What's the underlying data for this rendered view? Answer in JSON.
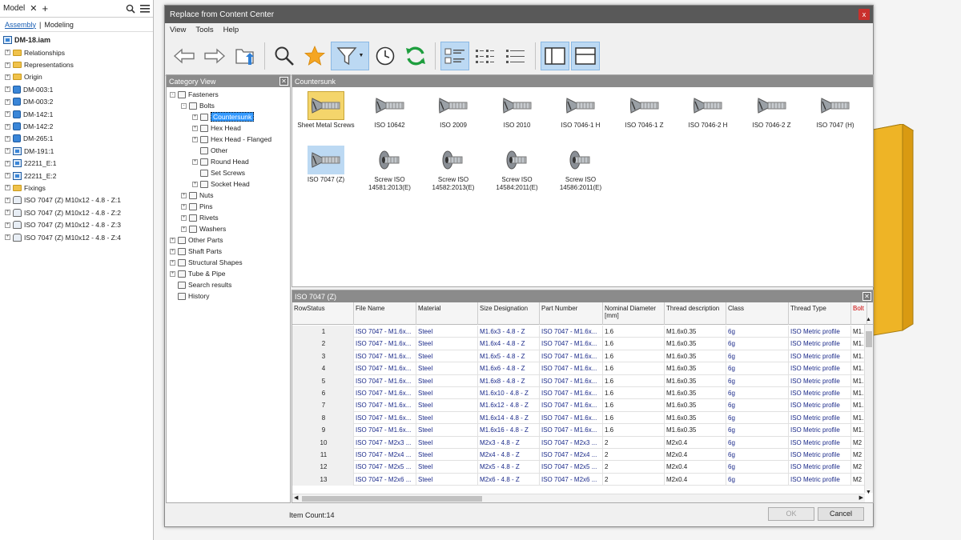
{
  "browser": {
    "tab": "Model",
    "modes": [
      "Assembly",
      "Modeling"
    ],
    "root": "DM-18.iam",
    "items": [
      {
        "label": "Relationships",
        "icon": "folder-icon"
      },
      {
        "label": "Representations",
        "icon": "folder-icon"
      },
      {
        "label": "Origin",
        "icon": "folder-icon"
      },
      {
        "label": "DM-003:1",
        "icon": "part-icon"
      },
      {
        "label": "DM-003:2",
        "icon": "part-icon"
      },
      {
        "label": "DM-142:1",
        "icon": "part-icon"
      },
      {
        "label": "DM-142:2",
        "icon": "part-icon"
      },
      {
        "label": "DM-265:1",
        "icon": "part-icon"
      },
      {
        "label": "DM-191:1",
        "icon": "assembly-icon"
      },
      {
        "label": "22211_E:1",
        "icon": "assembly-icon"
      },
      {
        "label": "22211_E:2",
        "icon": "assembly-icon"
      },
      {
        "label": "Fixings",
        "icon": "folder-icon"
      },
      {
        "label": "ISO 7047 (Z) M10x12 - 4.8 - Z:1",
        "icon": "content-center-part-icon"
      },
      {
        "label": "ISO 7047 (Z) M10x12 - 4.8 - Z:2",
        "icon": "content-center-part-icon"
      },
      {
        "label": "ISO 7047 (Z) M10x12 - 4.8 - Z:3",
        "icon": "content-center-part-icon"
      },
      {
        "label": "ISO 7047 (Z) M10x12 - 4.8 - Z:4",
        "icon": "content-center-part-icon"
      }
    ]
  },
  "dialog": {
    "title": "Replace from Content Center",
    "close": "x",
    "menu": [
      "View",
      "Tools",
      "Help"
    ],
    "category_panel": {
      "title": "Category View",
      "tree": [
        {
          "label": "Fasteners",
          "indent": 0,
          "expander": "-"
        },
        {
          "label": "Bolts",
          "indent": 1,
          "expander": "-"
        },
        {
          "label": "Countersunk",
          "indent": 2,
          "expander": "+",
          "selected": true
        },
        {
          "label": "Hex Head",
          "indent": 2,
          "expander": "+"
        },
        {
          "label": "Hex Head - Flanged",
          "indent": 2,
          "expander": "+"
        },
        {
          "label": "Other",
          "indent": 2,
          "expander": ""
        },
        {
          "label": "Round Head",
          "indent": 2,
          "expander": "+"
        },
        {
          "label": "Set Screws",
          "indent": 2,
          "expander": ""
        },
        {
          "label": "Socket Head",
          "indent": 2,
          "expander": "+"
        },
        {
          "label": "Nuts",
          "indent": 1,
          "expander": "+"
        },
        {
          "label": "Pins",
          "indent": 1,
          "expander": "+"
        },
        {
          "label": "Rivets",
          "indent": 1,
          "expander": "+"
        },
        {
          "label": "Washers",
          "indent": 1,
          "expander": "+"
        },
        {
          "label": "Other Parts",
          "indent": 0,
          "expander": "+"
        },
        {
          "label": "Shaft Parts",
          "indent": 0,
          "expander": "+"
        },
        {
          "label": "Structural Shapes",
          "indent": 0,
          "expander": "+"
        },
        {
          "label": "Tube & Pipe",
          "indent": 0,
          "expander": "+"
        },
        {
          "label": "Search results",
          "indent": 0,
          "expander": ""
        },
        {
          "label": "History",
          "indent": 0,
          "expander": ""
        }
      ]
    },
    "gallery": {
      "title": "Countersunk",
      "items": [
        {
          "label": "Sheet Metal Screws"
        },
        {
          "label": "ISO 10642"
        },
        {
          "label": "ISO 2009"
        },
        {
          "label": "ISO 2010"
        },
        {
          "label": "ISO 7046-1 H"
        },
        {
          "label": "ISO 7046-1 Z"
        },
        {
          "label": "ISO 7046-2 H"
        },
        {
          "label": "ISO 7046-2 Z"
        },
        {
          "label": "ISO 7047 (H)"
        },
        {
          "label": "ISO 7047 (Z)",
          "selected": true
        },
        {
          "label": "Screw ISO\n14581:2013(E)"
        },
        {
          "label": "Screw ISO\n14582:2013(E)"
        },
        {
          "label": "Screw ISO\n14584:2011(E)"
        },
        {
          "label": "Screw ISO\n14586:2011(E)"
        }
      ]
    },
    "table": {
      "title": "ISO 7047 (Z)",
      "columns": [
        "RowStatus",
        "File Name",
        "Material",
        "Size Designation",
        "Part Number",
        "Nominal Diameter [mm]",
        "Thread description",
        "Class",
        "Thread Type",
        "Bolt"
      ],
      "rows": [
        [
          "1",
          "ISO 7047 - M1.6x...",
          "Steel",
          "M1.6x3 - 4.8 - Z",
          "ISO 7047 - M1.6x...",
          "1.6",
          "M1.6x0.35",
          "6g",
          "ISO Metric profile",
          "M1."
        ],
        [
          "2",
          "ISO 7047 - M1.6x...",
          "Steel",
          "M1.6x4 - 4.8 - Z",
          "ISO 7047 - M1.6x...",
          "1.6",
          "M1.6x0.35",
          "6g",
          "ISO Metric profile",
          "M1."
        ],
        [
          "3",
          "ISO 7047 - M1.6x...",
          "Steel",
          "M1.6x5 - 4.8 - Z",
          "ISO 7047 - M1.6x...",
          "1.6",
          "M1.6x0.35",
          "6g",
          "ISO Metric profile",
          "M1."
        ],
        [
          "4",
          "ISO 7047 - M1.6x...",
          "Steel",
          "M1.6x6 - 4.8 - Z",
          "ISO 7047 - M1.6x...",
          "1.6",
          "M1.6x0.35",
          "6g",
          "ISO Metric profile",
          "M1."
        ],
        [
          "5",
          "ISO 7047 - M1.6x...",
          "Steel",
          "M1.6x8 - 4.8 - Z",
          "ISO 7047 - M1.6x...",
          "1.6",
          "M1.6x0.35",
          "6g",
          "ISO Metric profile",
          "M1."
        ],
        [
          "6",
          "ISO 7047 - M1.6x...",
          "Steel",
          "M1.6x10 - 4.8 - Z",
          "ISO 7047 - M1.6x...",
          "1.6",
          "M1.6x0.35",
          "6g",
          "ISO Metric profile",
          "M1."
        ],
        [
          "7",
          "ISO 7047 - M1.6x...",
          "Steel",
          "M1.6x12 - 4.8 - Z",
          "ISO 7047 - M1.6x...",
          "1.6",
          "M1.6x0.35",
          "6g",
          "ISO Metric profile",
          "M1."
        ],
        [
          "8",
          "ISO 7047 - M1.6x...",
          "Steel",
          "M1.6x14 - 4.8 - Z",
          "ISO 7047 - M1.6x...",
          "1.6",
          "M1.6x0.35",
          "6g",
          "ISO Metric profile",
          "M1."
        ],
        [
          "9",
          "ISO 7047 - M1.6x...",
          "Steel",
          "M1.6x16 - 4.8 - Z",
          "ISO 7047 - M1.6x...",
          "1.6",
          "M1.6x0.35",
          "6g",
          "ISO Metric profile",
          "M1."
        ],
        [
          "10",
          "ISO 7047 - M2x3 ...",
          "Steel",
          "M2x3 - 4.8 - Z",
          "ISO 7047 - M2x3 ...",
          "2",
          "M2x0.4",
          "6g",
          "ISO Metric profile",
          "M2"
        ],
        [
          "11",
          "ISO 7047 - M2x4 ...",
          "Steel",
          "M2x4 - 4.8 - Z",
          "ISO 7047 - M2x4 ...",
          "2",
          "M2x0.4",
          "6g",
          "ISO Metric profile",
          "M2"
        ],
        [
          "12",
          "ISO 7047 - M2x5 ...",
          "Steel",
          "M2x5 - 4.8 - Z",
          "ISO 7047 - M2x5 ...",
          "2",
          "M2x0.4",
          "6g",
          "ISO Metric profile",
          "M2"
        ],
        [
          "13",
          "ISO 7047 - M2x6 ...",
          "Steel",
          "M2x6 - 4.8 - Z",
          "ISO 7047 - M2x6 ...",
          "2",
          "M2x0.4",
          "6g",
          "ISO Metric profile",
          "M2"
        ]
      ]
    },
    "footer": {
      "item_count": "Item Count:14",
      "ok": "OK",
      "cancel": "Cancel"
    }
  },
  "colors": {
    "title_bar": "#595959",
    "panel_header": "#8b8b8b",
    "selection": "#3399ff",
    "toolbar_selected": "#bcd9f3",
    "link_text": "#1b2a8a",
    "close_red": "#c9302c"
  }
}
